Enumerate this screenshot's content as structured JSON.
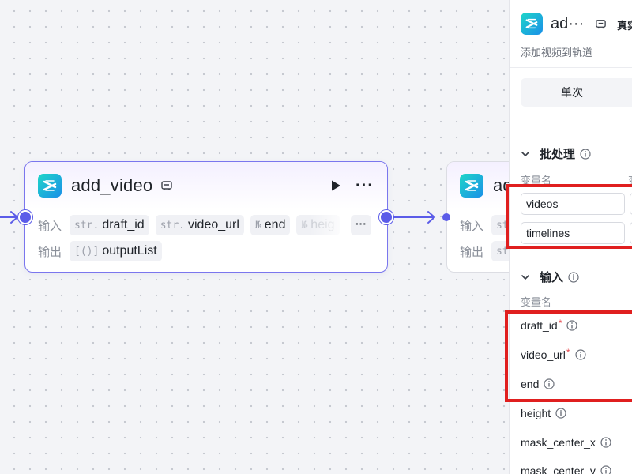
{
  "node_main": {
    "title": "add_video",
    "input_label": "输入",
    "output_label": "输出",
    "inputs": [
      {
        "type": "str.",
        "name": "draft_id"
      },
      {
        "type": "str.",
        "name": "video_url"
      },
      {
        "type": "№",
        "name": "end"
      },
      {
        "type": "№",
        "name": "heig"
      }
    ],
    "more_inputs": "···",
    "outputs": [
      {
        "type": "[()]",
        "name": "outputList"
      }
    ]
  },
  "node_next": {
    "title": "ad",
    "input_label": "输入",
    "output_label": "输出",
    "input_type": "str",
    "output_type": "str."
  },
  "panel": {
    "title": "ad···",
    "real_run": "真实",
    "description": "添加视频到轨道",
    "tab_single": "单次",
    "batch": {
      "title": "批处理",
      "col_var": "变量名",
      "col_other": "变",
      "rows": [
        "videos",
        "timelines"
      ]
    },
    "inputs": {
      "title": "输入",
      "col_var": "变量名",
      "params": [
        {
          "name": "draft_id",
          "required": "*"
        },
        {
          "name": "video_url",
          "required": "*"
        },
        {
          "name": "end"
        },
        {
          "name": "height"
        },
        {
          "name": "mask_center_x"
        },
        {
          "name": "mask_center_y"
        }
      ]
    }
  },
  "colors": {
    "accent": "#5b5ce8",
    "highlight": "#e01f1f",
    "node_border": "#7a76ee"
  }
}
